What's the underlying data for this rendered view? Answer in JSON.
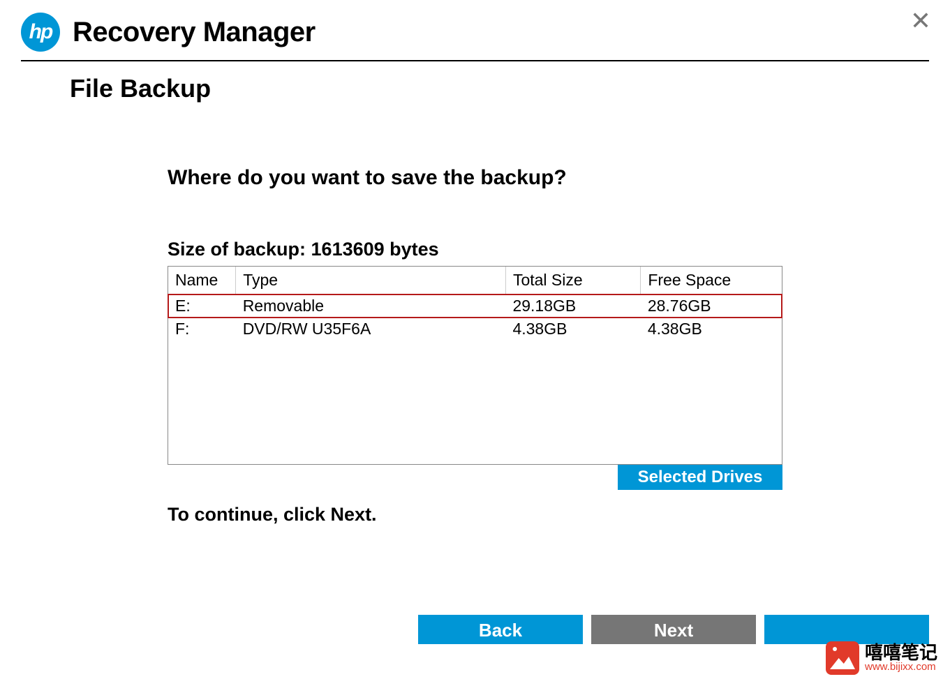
{
  "header": {
    "logo_text": "hp",
    "app_title": "Recovery Manager"
  },
  "page": {
    "title": "File Backup",
    "question": "Where do you want to save the backup?",
    "size_label": "Size of backup: 1613609 bytes",
    "continue_msg": "To continue, click Next."
  },
  "table": {
    "headers": {
      "name": "Name",
      "type": "Type",
      "total": "Total Size",
      "free": "Free Space"
    },
    "rows": [
      {
        "name": "E:",
        "type": "Removable",
        "total": "29.18GB",
        "free": "28.76GB",
        "selected": true
      },
      {
        "name": "F:",
        "type": "DVD/RW U35F6A",
        "total": "4.38GB",
        "free": "4.38GB",
        "selected": false
      }
    ]
  },
  "buttons": {
    "selected_drives": "Selected Drives",
    "back": "Back",
    "next": "Next",
    "third": ""
  },
  "watermark": {
    "cn": "嘻嘻笔记",
    "en": "www.bijixx.com"
  }
}
